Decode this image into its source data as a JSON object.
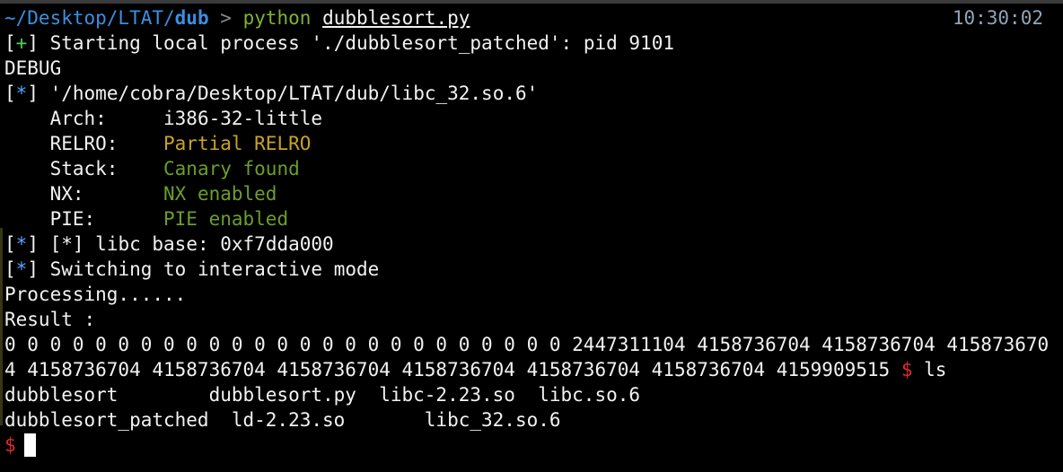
{
  "prompt": {
    "cwd_prefix": "~/Desktop/LTAT/",
    "cwd_dir": "dub",
    "arrow": ">",
    "cmd": "python",
    "arg": "dubblesort.py",
    "clock": "10:30:02"
  },
  "output": {
    "start_open": "[",
    "start_sym": "+",
    "start_close": "]",
    "start_text": " Starting local process './dubblesort_patched': pid 9101",
    "debug": "DEBUG",
    "star_open": "[",
    "star_sym": "*",
    "star_close": "]",
    "libc_path": " '/home/cobra/Desktop/LTAT/dub/libc_32.so.6'",
    "arch_label": "    Arch:     ",
    "arch_value": "i386-32-little",
    "relro_label": "    RELRO:    ",
    "relro_value": "Partial RELRO",
    "stack_label": "    Stack:    ",
    "stack_value": "Canary found",
    "nx_label": "    NX:       ",
    "nx_value": "NX enabled",
    "pie_label": "    PIE:      ",
    "pie_value": "PIE enabled",
    "libc_base": " [*] libc base: 0xf7dda000",
    "switching": " Switching to interactive mode",
    "processing": "Processing......",
    "result": "Result :",
    "result_line1": "0 0 0 0 0 0 0 0 0 0 0 0 0 0 0 0 0 0 0 0 0 0 0 0 0 2447311104 4158736704 4158736704 415873670",
    "result_line2": "4 4158736704 4158736704 4158736704 4158736704 4158736704 4158736704 4159909515 ",
    "prompt_dollar": "$",
    "ls_cmd": " ls",
    "ls_row1": "dubblesort        dubblesort.py  libc-2.23.so  libc.so.6",
    "ls_row2": "dubblesort_patched  ld-2.23.so       libc_32.so.6",
    "final_dollar": "$"
  }
}
